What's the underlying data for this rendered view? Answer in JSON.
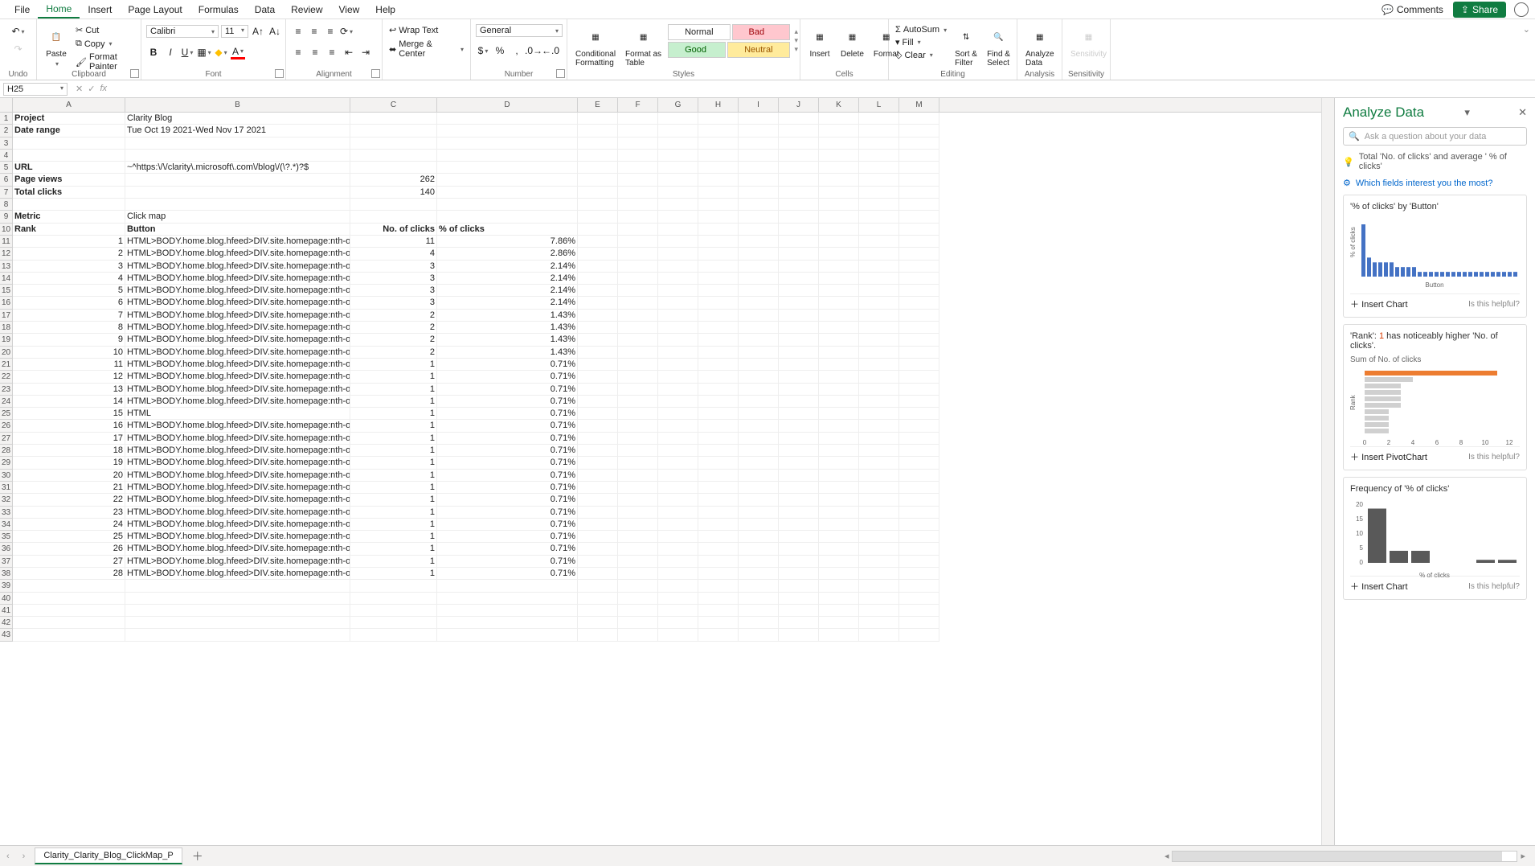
{
  "menu": {
    "items": [
      "File",
      "Home",
      "Insert",
      "Page Layout",
      "Formulas",
      "Data",
      "Review",
      "View",
      "Help"
    ],
    "comments": "Comments",
    "share": "Share"
  },
  "ribbon": {
    "undo": "Undo",
    "paste": "Paste",
    "cut": "Cut",
    "copy": "Copy",
    "formatPainter": "Format Painter",
    "clipboard": "Clipboard",
    "fontName": "Calibri",
    "fontSize": "11",
    "font": "Font",
    "wrap": "Wrap Text",
    "merge": "Merge & Center",
    "alignment": "Alignment",
    "numFormat": "General",
    "number": "Number",
    "condFmt": "Conditional\nFormatting",
    "fmtTable": "Format as\nTable",
    "normal": "Normal",
    "bad": "Bad",
    "good": "Good",
    "neutral": "Neutral",
    "styles": "Styles",
    "insert": "Insert",
    "delete": "Delete",
    "format": "Format",
    "cells": "Cells",
    "autosum": "AutoSum",
    "fill": "Fill",
    "clear": "Clear",
    "sortFilter": "Sort &\nFilter",
    "findSelect": "Find &\nSelect",
    "editing": "Editing",
    "analyze": "Analyze\nData",
    "analysis": "Analysis",
    "sensitivity": "Sensitivity",
    "sensGroup": "Sensitivity"
  },
  "nameBox": "H25",
  "cols": [
    "A",
    "B",
    "C",
    "D",
    "E",
    "F",
    "G",
    "H",
    "I",
    "J",
    "K",
    "L",
    "M"
  ],
  "meta": {
    "project_l": "Project",
    "project_v": "Clarity Blog",
    "date_l": "Date range",
    "date_v": "Tue Oct 19 2021-Wed Nov 17 2021",
    "url_l": "URL",
    "url_v": "~^https:\\/\\/clarity\\.microsoft\\.com\\/blog\\/(\\?.*)?$",
    "pv_l": "Page views",
    "pv_v": "262",
    "tc_l": "Total clicks",
    "tc_v": "140",
    "metric_l": "Metric",
    "metric_v": "Click map",
    "rank_h": "Rank",
    "button_h": "Button",
    "clicks_h": "No. of clicks",
    "pct_h": "% of clicks"
  },
  "rows": [
    {
      "r": 1,
      "b": "HTML>BODY.home.blog.hfeed>DIV.site.homepage:nth-of-t",
      "n": 11,
      "p": "7.86%"
    },
    {
      "r": 2,
      "b": "HTML>BODY.home.blog.hfeed>DIV.site.homepage:nth-of-t",
      "n": 4,
      "p": "2.86%"
    },
    {
      "r": 3,
      "b": "HTML>BODY.home.blog.hfeed>DIV.site.homepage:nth-of-t",
      "n": 3,
      "p": "2.14%"
    },
    {
      "r": 4,
      "b": "HTML>BODY.home.blog.hfeed>DIV.site.homepage:nth-of-t",
      "n": 3,
      "p": "2.14%"
    },
    {
      "r": 5,
      "b": "HTML>BODY.home.blog.hfeed>DIV.site.homepage:nth-of-t",
      "n": 3,
      "p": "2.14%"
    },
    {
      "r": 6,
      "b": "HTML>BODY.home.blog.hfeed>DIV.site.homepage:nth-of-t",
      "n": 3,
      "p": "2.14%"
    },
    {
      "r": 7,
      "b": "HTML>BODY.home.blog.hfeed>DIV.site.homepage:nth-of-t",
      "n": 2,
      "p": "1.43%"
    },
    {
      "r": 8,
      "b": "HTML>BODY.home.blog.hfeed>DIV.site.homepage:nth-of-t",
      "n": 2,
      "p": "1.43%"
    },
    {
      "r": 9,
      "b": "HTML>BODY.home.blog.hfeed>DIV.site.homepage:nth-of-t",
      "n": 2,
      "p": "1.43%"
    },
    {
      "r": 10,
      "b": "HTML>BODY.home.blog.hfeed>DIV.site.homepage:nth-of-t",
      "n": 2,
      "p": "1.43%"
    },
    {
      "r": 11,
      "b": "HTML>BODY.home.blog.hfeed>DIV.site.homepage:nth-of-t",
      "n": 1,
      "p": "0.71%"
    },
    {
      "r": 12,
      "b": "HTML>BODY.home.blog.hfeed>DIV.site.homepage:nth-of-t",
      "n": 1,
      "p": "0.71%"
    },
    {
      "r": 13,
      "b": "HTML>BODY.home.blog.hfeed>DIV.site.homepage:nth-of-t",
      "n": 1,
      "p": "0.71%"
    },
    {
      "r": 14,
      "b": "HTML>BODY.home.blog.hfeed>DIV.site.homepage:nth-of-t",
      "n": 1,
      "p": "0.71%"
    },
    {
      "r": 15,
      "b": "HTML",
      "n": 1,
      "p": "0.71%"
    },
    {
      "r": 16,
      "b": "HTML>BODY.home.blog.hfeed>DIV.site.homepage:nth-of-t",
      "n": 1,
      "p": "0.71%"
    },
    {
      "r": 17,
      "b": "HTML>BODY.home.blog.hfeed>DIV.site.homepage:nth-of-t",
      "n": 1,
      "p": "0.71%"
    },
    {
      "r": 18,
      "b": "HTML>BODY.home.blog.hfeed>DIV.site.homepage:nth-of-t",
      "n": 1,
      "p": "0.71%"
    },
    {
      "r": 19,
      "b": "HTML>BODY.home.blog.hfeed>DIV.site.homepage:nth-of-t",
      "n": 1,
      "p": "0.71%"
    },
    {
      "r": 20,
      "b": "HTML>BODY.home.blog.hfeed>DIV.site.homepage:nth-of-t",
      "n": 1,
      "p": "0.71%"
    },
    {
      "r": 21,
      "b": "HTML>BODY.home.blog.hfeed>DIV.site.homepage:nth-of-t",
      "n": 1,
      "p": "0.71%"
    },
    {
      "r": 22,
      "b": "HTML>BODY.home.blog.hfeed>DIV.site.homepage:nth-of-t",
      "n": 1,
      "p": "0.71%"
    },
    {
      "r": 23,
      "b": "HTML>BODY.home.blog.hfeed>DIV.site.homepage:nth-of-t",
      "n": 1,
      "p": "0.71%"
    },
    {
      "r": 24,
      "b": "HTML>BODY.home.blog.hfeed>DIV.site.homepage:nth-of-t",
      "n": 1,
      "p": "0.71%"
    },
    {
      "r": 25,
      "b": "HTML>BODY.home.blog.hfeed>DIV.site.homepage:nth-of-t",
      "n": 1,
      "p": "0.71%"
    },
    {
      "r": 26,
      "b": "HTML>BODY.home.blog.hfeed>DIV.site.homepage:nth-of-t",
      "n": 1,
      "p": "0.71%"
    },
    {
      "r": 27,
      "b": "HTML>BODY.home.blog.hfeed>DIV.site.homepage:nth-of-t",
      "n": 1,
      "p": "0.71%"
    },
    {
      "r": 28,
      "b": "HTML>BODY.home.blog.hfeed>DIV.site.homepage:nth-of-t",
      "n": 1,
      "p": "0.71%"
    }
  ],
  "pane": {
    "title": "Analyze Data",
    "searchPh": "Ask a question about your data",
    "sugg": "Total 'No. of clicks' and average ' % of clicks'",
    "fields": "Which fields interest you the most?",
    "card1": {
      "t": "'% of clicks' by 'Button'",
      "xl": "Button",
      "yl": "% of clicks",
      "ins": "Insert Chart",
      "hlp": "Is this helpful?"
    },
    "card2": {
      "t1": "'Rank': ",
      "t2": "1",
      "t3": " has noticeably higher 'No. of clicks'.",
      "sub": "Sum of No. of clicks",
      "xl": "Rank",
      "ticks": [
        "0",
        "2",
        "4",
        "6",
        "8",
        "10",
        "12"
      ],
      "ins": "Insert PivotChart",
      "hlp": "Is this helpful?"
    },
    "card3": {
      "t": "Frequency of '% of clicks'",
      "xl": "% of clicks",
      "yt": [
        "0",
        "5",
        "10",
        "15",
        "20"
      ],
      "ins": "Insert Chart",
      "hlp": "Is this helpful?"
    }
  },
  "tab": "Clarity_Clarity_Blog_ClickMap_P",
  "chart_data": [
    {
      "type": "bar",
      "title": "'% of clicks' by 'Button'",
      "xlabel": "Button",
      "ylabel": "% of clicks",
      "values": [
        7.86,
        2.86,
        2.14,
        2.14,
        2.14,
        2.14,
        1.43,
        1.43,
        1.43,
        1.43,
        0.71,
        0.71,
        0.71,
        0.71,
        0.71,
        0.71,
        0.71,
        0.71,
        0.71,
        0.71,
        0.71,
        0.71,
        0.71,
        0.71,
        0.71,
        0.71,
        0.71,
        0.71
      ]
    },
    {
      "type": "bar",
      "orientation": "h",
      "title": "Sum of No. of clicks by Rank",
      "xlabel": "Rank",
      "highlight_index": 0,
      "values": [
        11,
        4,
        3,
        3,
        3,
        3,
        2,
        2,
        2,
        2
      ],
      "xlim": [
        0,
        12
      ]
    },
    {
      "type": "bar",
      "title": "Frequency of '% of clicks'",
      "xlabel": "% of clicks",
      "values": [
        18,
        4,
        4,
        0,
        0,
        1,
        1
      ],
      "ylim": [
        0,
        20
      ]
    }
  ]
}
